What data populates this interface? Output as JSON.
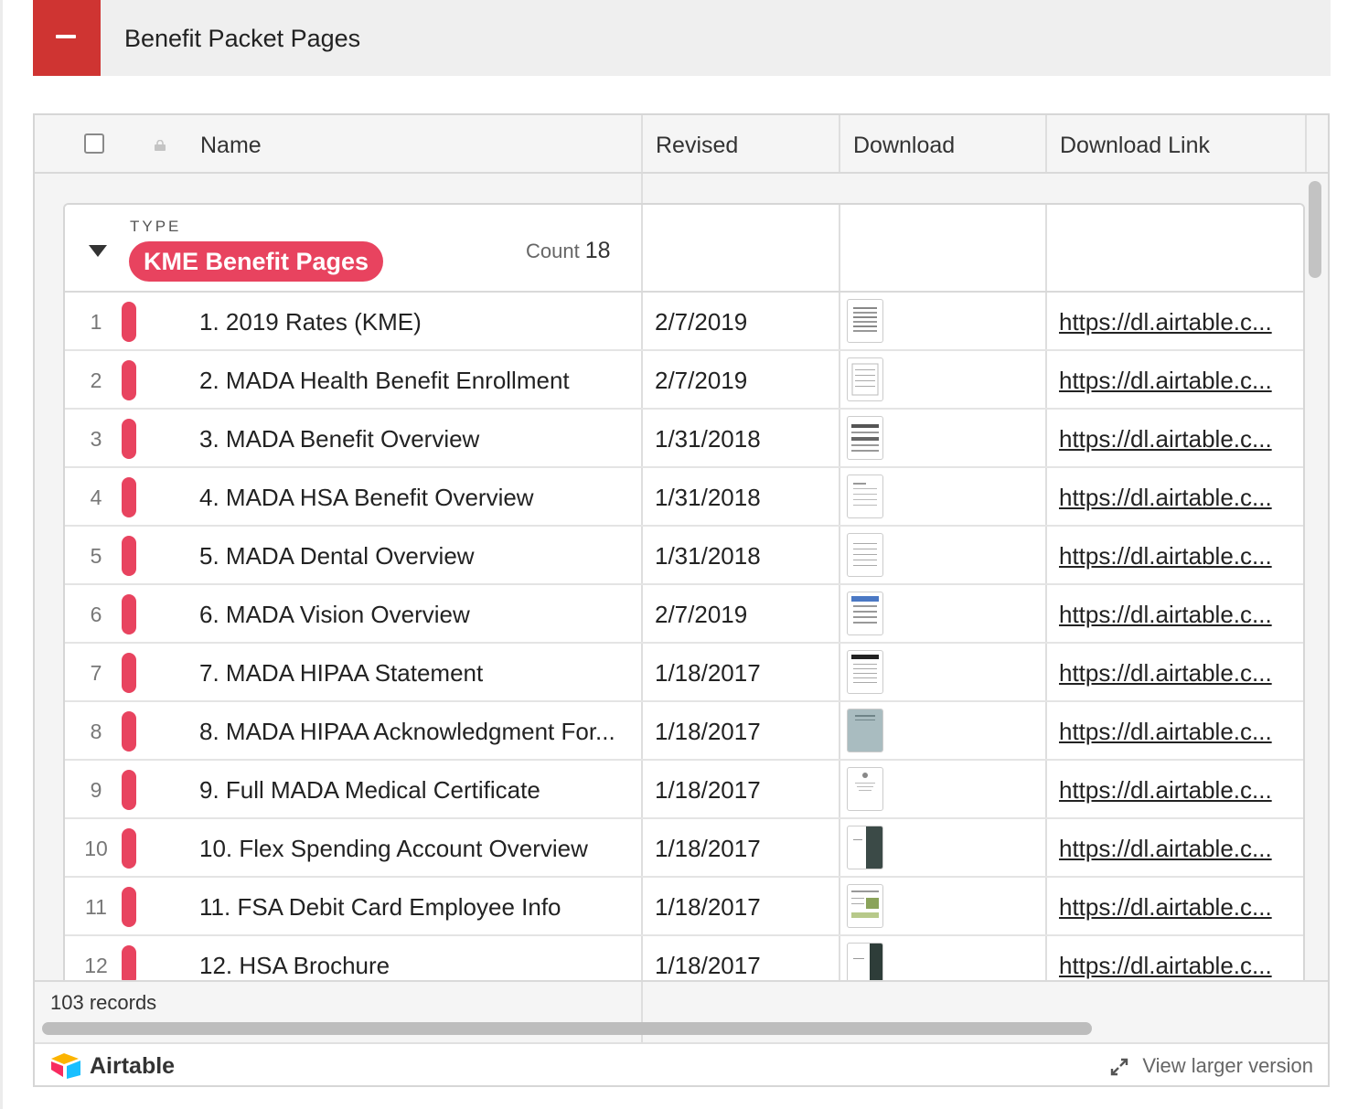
{
  "section": {
    "title": "Benefit Packet Pages"
  },
  "table": {
    "columns": [
      "Name",
      "Revised",
      "Download",
      "Download Link"
    ],
    "group": {
      "field_label": "TYPE",
      "value": "KME Benefit Pages",
      "count_label": "Count",
      "count": "18"
    },
    "rows": [
      {
        "num": "1",
        "name": "1. 2019 Rates (KME)",
        "revised": "2/7/2019",
        "link": "https://dl.airtable.c..."
      },
      {
        "num": "2",
        "name": "2. MADA Health Benefit Enrollment",
        "revised": "2/7/2019",
        "link": "https://dl.airtable.c..."
      },
      {
        "num": "3",
        "name": "3. MADA Benefit Overview",
        "revised": "1/31/2018",
        "link": "https://dl.airtable.c..."
      },
      {
        "num": "4",
        "name": "4. MADA HSA Benefit Overview",
        "revised": "1/31/2018",
        "link": "https://dl.airtable.c..."
      },
      {
        "num": "5",
        "name": "5. MADA Dental Overview",
        "revised": "1/31/2018",
        "link": "https://dl.airtable.c..."
      },
      {
        "num": "6",
        "name": "6. MADA Vision Overview",
        "revised": "2/7/2019",
        "link": "https://dl.airtable.c..."
      },
      {
        "num": "7",
        "name": "7. MADA HIPAA Statement",
        "revised": "1/18/2017",
        "link": "https://dl.airtable.c..."
      },
      {
        "num": "8",
        "name": "8. MADA HIPAA Acknowledgment For...",
        "revised": "1/18/2017",
        "link": "https://dl.airtable.c..."
      },
      {
        "num": "9",
        "name": "9. Full MADA Medical Certificate",
        "revised": "1/18/2017",
        "link": "https://dl.airtable.c..."
      },
      {
        "num": "10",
        "name": "10. Flex Spending Account Overview",
        "revised": "1/18/2017",
        "link": "https://dl.airtable.c..."
      },
      {
        "num": "11",
        "name": "11. FSA Debit Card Employee Info",
        "revised": "1/18/2017",
        "link": "https://dl.airtable.c..."
      },
      {
        "num": "12",
        "name": "12. HSA Brochure",
        "revised": "1/18/2017",
        "link": "https://dl.airtable.c..."
      }
    ],
    "record_count": "103 records"
  },
  "footer": {
    "brand": "Airtable",
    "view_larger": "View larger version"
  },
  "colors": {
    "accent_red": "#cf3432",
    "pill_pink": "#e8435f"
  }
}
